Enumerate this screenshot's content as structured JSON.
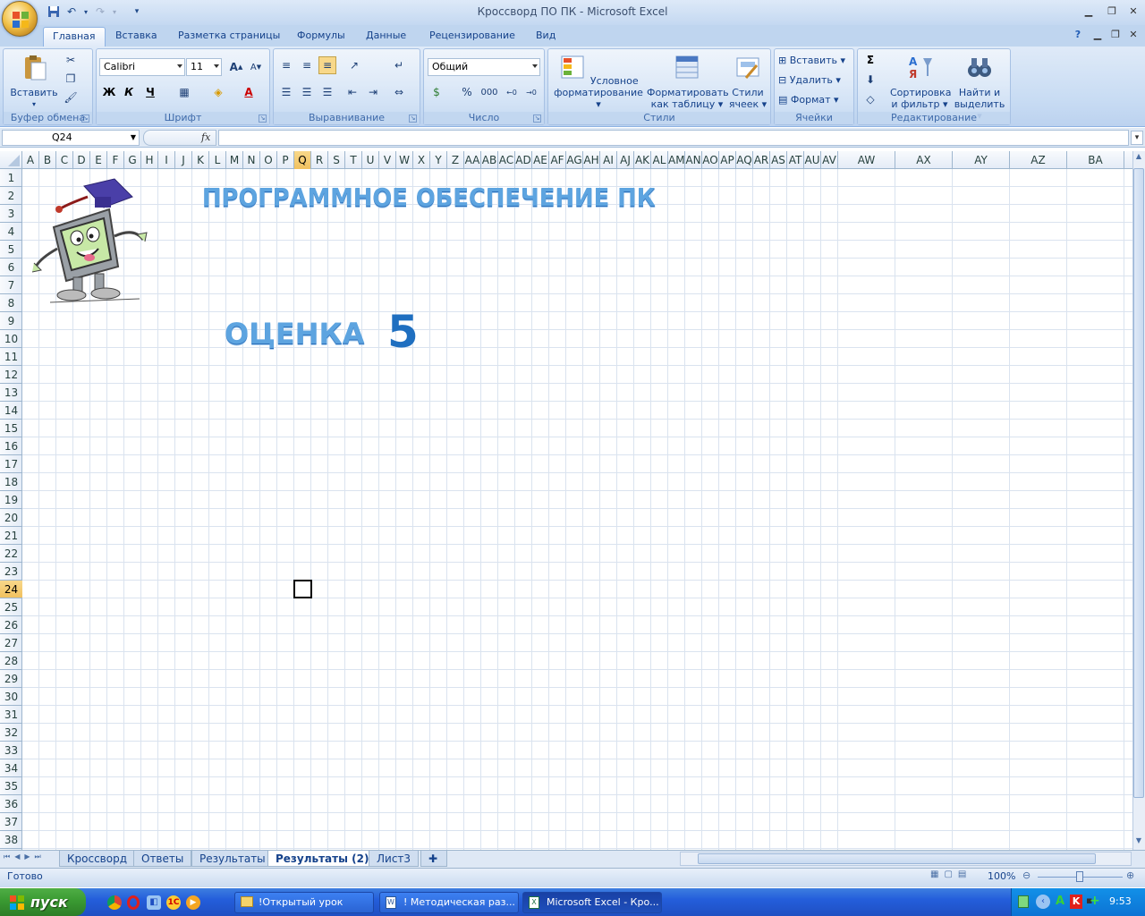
{
  "window": {
    "title": "Кроссворд ПО ПК - Microsoft Excel"
  },
  "ribbon_tabs": [
    "Главная",
    "Вставка",
    "Разметка страницы",
    "Формулы",
    "Данные",
    "Рецензирование",
    "Вид"
  ],
  "groups": {
    "clipboard": {
      "label": "Буфер обмена",
      "paste": "Вставить"
    },
    "font": {
      "label": "Шрифт",
      "font_name": "Calibri",
      "font_size": "11",
      "bold": "Ж",
      "italic": "К",
      "underline": "Ч"
    },
    "alignment": {
      "label": "Выравнивание"
    },
    "number": {
      "label": "Число",
      "format": "Общий",
      "percent": "%",
      "thousands": "000"
    },
    "styles": {
      "label": "Стили",
      "cond_format": "Условное форматирование",
      "format_table": "Форматировать как таблицу",
      "cell_styles": "Стили ячеек"
    },
    "cells": {
      "label": "Ячейки",
      "insert": "Вставить",
      "delete": "Удалить",
      "format": "Формат"
    },
    "editing": {
      "label": "Редактирование",
      "sort": "Сортировка и фильтр",
      "find": "Найти и выделить"
    }
  },
  "formula_bar": {
    "name_box": "Q24",
    "fx": "fx",
    "value": ""
  },
  "columns": [
    "A",
    "B",
    "C",
    "D",
    "E",
    "F",
    "G",
    "H",
    "I",
    "J",
    "K",
    "L",
    "M",
    "N",
    "O",
    "P",
    "Q",
    "R",
    "S",
    "T",
    "U",
    "V",
    "W",
    "X",
    "Y",
    "Z",
    "AA",
    "AB",
    "AC",
    "AD",
    "AE",
    "AF",
    "AG",
    "AH",
    "AI",
    "AJ",
    "AK",
    "AL",
    "AM",
    "AN",
    "AO",
    "AP",
    "AQ",
    "AR",
    "AS",
    "AT",
    "AU",
    "AV",
    "AW",
    "AX",
    "AY",
    "AZ",
    "BA"
  ],
  "selected_cell": {
    "column": "Q",
    "row": "24"
  },
  "rows": [
    "1",
    "2",
    "3",
    "4",
    "5",
    "6",
    "7",
    "8",
    "9",
    "10",
    "11",
    "12",
    "13",
    "14",
    "15",
    "16",
    "17",
    "18",
    "19",
    "20",
    "21",
    "22",
    "23",
    "24",
    "25",
    "26",
    "27",
    "28",
    "29",
    "30",
    "31",
    "32",
    "33",
    "34",
    "35",
    "36",
    "37",
    "38"
  ],
  "sheet": {
    "heading": "ПРОГРАММНОЕ ОБЕСПЕЧЕНИЕ ПК",
    "grade_label": "ОЦЕНКА",
    "grade_value": "5"
  },
  "sheet_tabs": [
    "Кроссворд",
    "Ответы",
    "Результаты",
    "Результаты (2)",
    "Лист3"
  ],
  "active_sheet": "Результаты (2)",
  "status": {
    "text": "Готово",
    "zoom": "100%"
  },
  "taskbar": {
    "start": "пуск",
    "tasks": [
      "!Открытый урок",
      "! Методическая раз...",
      "Microsoft Excel - Кро..."
    ],
    "clock": "9:53"
  },
  "colors": {
    "accent": "#15428b",
    "ribbon": "#c7dbf3",
    "taskbar": "#245edb",
    "start": "#3a9a32",
    "heading": "#5da4e0",
    "grade": "#1f6fc0"
  }
}
